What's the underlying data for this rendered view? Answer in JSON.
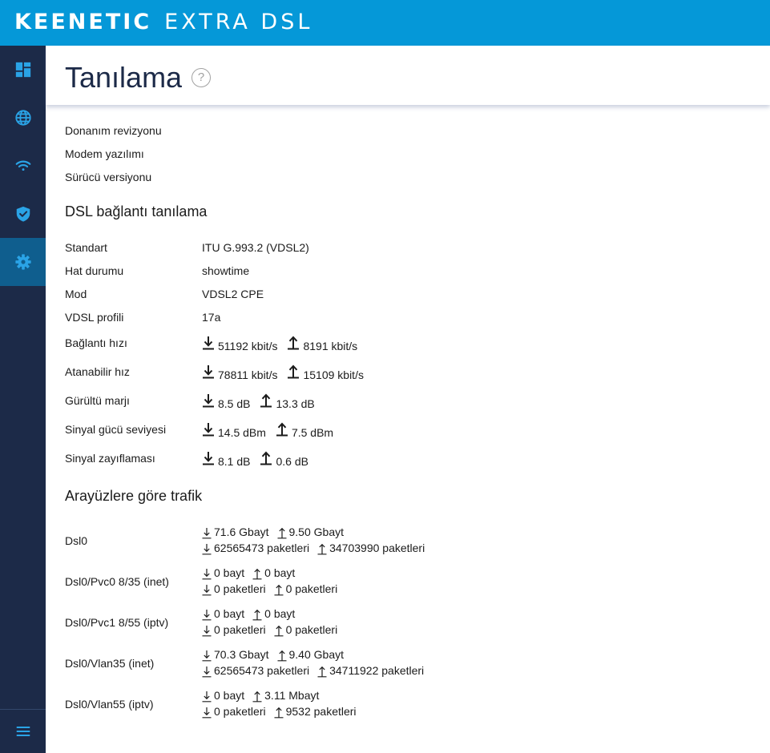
{
  "brand": {
    "name": "KEENETIC",
    "model": "EXTRA DSL"
  },
  "colors": {
    "topbar": "#0598d8",
    "sidebar": "#1c2a48",
    "sidebar_active": "#0f5e8e",
    "icon": "#2aa3e6"
  },
  "sidebar": {
    "items": [
      {
        "name": "dashboard",
        "icon": "dashboard-icon"
      },
      {
        "name": "internet",
        "icon": "globe-icon"
      },
      {
        "name": "wifi",
        "icon": "wifi-icon"
      },
      {
        "name": "security",
        "icon": "shield-icon"
      },
      {
        "name": "management",
        "icon": "gear-icon",
        "active": true
      }
    ],
    "menu_icon": "hamburger-menu-icon"
  },
  "header": {
    "title": "Tanılama",
    "help_glyph": "?"
  },
  "device_info": [
    "Donanım revizyonu",
    "Modem yazılımı",
    "Sürücü versiyonu"
  ],
  "dsl": {
    "title": "DSL bağlantı tanılama",
    "rows": [
      {
        "label": "Standart",
        "value": "ITU G.993.2 (VDSL2)"
      },
      {
        "label": "Hat durumu",
        "value": "showtime"
      },
      {
        "label": "Mod",
        "value": "VDSL2 CPE"
      },
      {
        "label": "VDSL profili",
        "value": "17a"
      }
    ],
    "rates": [
      {
        "label": "Bağlantı hızı",
        "down": "51192 kbit/s",
        "up": "8191 kbit/s"
      },
      {
        "label": "Atanabilir hız",
        "down": "78811 kbit/s",
        "up": "15109 kbit/s"
      },
      {
        "label": "Gürültü marjı",
        "down": "8.5 dB",
        "up": "13.3 dB"
      },
      {
        "label": "Sinyal gücü seviyesi",
        "down": "14.5 dBm",
        "up": "7.5 dBm"
      },
      {
        "label": "Sinyal zayıflaması",
        "down": "8.1 dB",
        "up": "0.6 dB"
      }
    ]
  },
  "traffic": {
    "title": "Arayüzlere göre trafik",
    "interfaces": [
      {
        "name": "Dsl0",
        "down_bytes": "71.6 Gbayt",
        "up_bytes": "9.50 Gbayt",
        "down_packets": "62565473 paketleri",
        "up_packets": "34703990 paketleri"
      },
      {
        "name": "Dsl0/Pvc0 8/35 (inet)",
        "down_bytes": "0 bayt",
        "up_bytes": "0 bayt",
        "down_packets": "0 paketleri",
        "up_packets": "0 paketleri"
      },
      {
        "name": "Dsl0/Pvc1 8/55 (iptv)",
        "down_bytes": "0 bayt",
        "up_bytes": "0 bayt",
        "down_packets": "0 paketleri",
        "up_packets": "0 paketleri"
      },
      {
        "name": "Dsl0/Vlan35 (inet)",
        "down_bytes": "70.3 Gbayt",
        "up_bytes": "9.40 Gbayt",
        "down_packets": "62565473 paketleri",
        "up_packets": "34711922 paketleri"
      },
      {
        "name": "Dsl0/Vlan55 (iptv)",
        "down_bytes": "0 bayt",
        "up_bytes": "3.11 Mbayt",
        "down_packets": "0 paketleri",
        "up_packets": "9532 paketleri"
      }
    ]
  }
}
